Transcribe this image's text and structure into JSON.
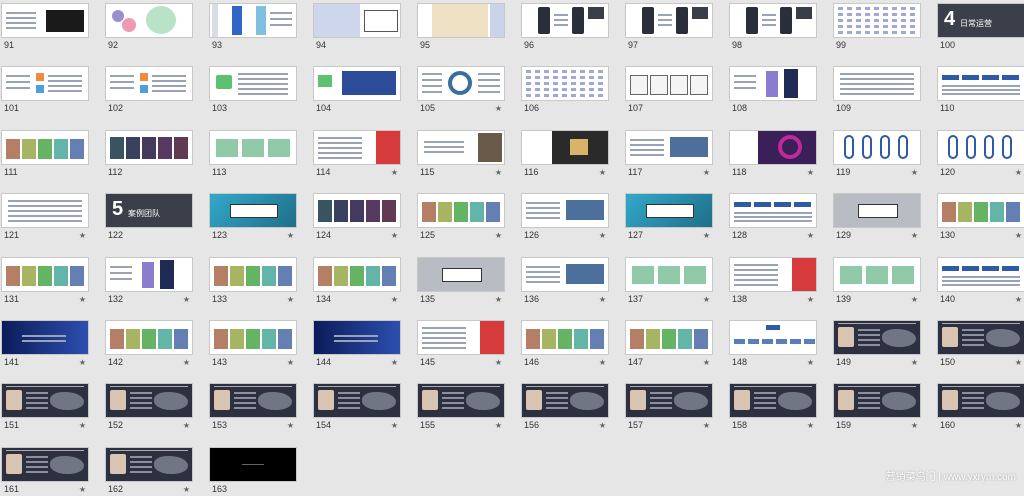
{
  "slides": [
    {
      "n": "91",
      "star": false,
      "style": "split-dark"
    },
    {
      "n": "92",
      "star": false,
      "style": "circles"
    },
    {
      "n": "93",
      "star": false,
      "style": "poster"
    },
    {
      "n": "94",
      "star": false,
      "style": "poster-blue"
    },
    {
      "n": "95",
      "star": false,
      "style": "map-beige"
    },
    {
      "n": "96",
      "star": false,
      "style": "phones"
    },
    {
      "n": "97",
      "star": false,
      "style": "phones"
    },
    {
      "n": "98",
      "star": false,
      "style": "phones"
    },
    {
      "n": "99",
      "star": false,
      "style": "pattern"
    },
    {
      "n": "100",
      "star": false,
      "style": "section",
      "sectionNum": "4",
      "sectionTitle": "日常运营"
    },
    {
      "n": "101",
      "star": false,
      "style": "text-icons"
    },
    {
      "n": "102",
      "star": false,
      "style": "text-icons"
    },
    {
      "n": "103",
      "star": false,
      "style": "green-box"
    },
    {
      "n": "104",
      "star": false,
      "style": "green-blue"
    },
    {
      "n": "105",
      "star": true,
      "style": "wheel"
    },
    {
      "n": "106",
      "star": false,
      "style": "pattern"
    },
    {
      "n": "107",
      "star": false,
      "style": "frames"
    },
    {
      "n": "108",
      "star": false,
      "style": "purple-phone"
    },
    {
      "n": "109",
      "star": false,
      "style": "text"
    },
    {
      "n": "110",
      "star": false,
      "style": "blue-table"
    },
    {
      "n": "111",
      "star": false,
      "style": "photos"
    },
    {
      "n": "112",
      "star": false,
      "style": "photos-dark"
    },
    {
      "n": "113",
      "star": false,
      "style": "green-photos"
    },
    {
      "n": "114",
      "star": true,
      "style": "red-right"
    },
    {
      "n": "115",
      "star": true,
      "style": "photo-right"
    },
    {
      "n": "116",
      "star": true,
      "style": "dark-center"
    },
    {
      "n": "117",
      "star": true,
      "style": "text-photo"
    },
    {
      "n": "118",
      "star": true,
      "style": "purple-spiral"
    },
    {
      "n": "119",
      "star": true,
      "style": "pipes"
    },
    {
      "n": "120",
      "star": true,
      "style": "pipes"
    },
    {
      "n": "121",
      "star": true,
      "style": "text"
    },
    {
      "n": "122",
      "star": false,
      "style": "section",
      "sectionNum": "5",
      "sectionTitle": "案例团队"
    },
    {
      "n": "123",
      "star": true,
      "style": "pool"
    },
    {
      "n": "124",
      "star": true,
      "style": "photos-dark"
    },
    {
      "n": "125",
      "star": true,
      "style": "photos"
    },
    {
      "n": "126",
      "star": true,
      "style": "text-photo"
    },
    {
      "n": "127",
      "star": true,
      "style": "pool"
    },
    {
      "n": "128",
      "star": true,
      "style": "blue-table"
    },
    {
      "n": "129",
      "star": true,
      "style": "building"
    },
    {
      "n": "130",
      "star": true,
      "style": "photos"
    },
    {
      "n": "131",
      "star": true,
      "style": "photos"
    },
    {
      "n": "132",
      "star": true,
      "style": "purple-phone"
    },
    {
      "n": "133",
      "star": true,
      "style": "photos"
    },
    {
      "n": "134",
      "star": true,
      "style": "photos"
    },
    {
      "n": "135",
      "star": true,
      "style": "building"
    },
    {
      "n": "136",
      "star": true,
      "style": "text-photo"
    },
    {
      "n": "137",
      "star": true,
      "style": "green-photos"
    },
    {
      "n": "138",
      "star": true,
      "style": "red-right"
    },
    {
      "n": "139",
      "star": true,
      "style": "green-photos"
    },
    {
      "n": "140",
      "star": true,
      "style": "blue-table"
    },
    {
      "n": "141",
      "star": true,
      "style": "blue-banner"
    },
    {
      "n": "142",
      "star": true,
      "style": "photos"
    },
    {
      "n": "143",
      "star": true,
      "style": "photos"
    },
    {
      "n": "144",
      "star": true,
      "style": "blue-banner"
    },
    {
      "n": "145",
      "star": true,
      "style": "red-right"
    },
    {
      "n": "146",
      "star": true,
      "style": "photos"
    },
    {
      "n": "147",
      "star": true,
      "style": "photos"
    },
    {
      "n": "148",
      "star": true,
      "style": "org-chart"
    },
    {
      "n": "149",
      "star": true,
      "style": "team"
    },
    {
      "n": "150",
      "star": true,
      "style": "team"
    },
    {
      "n": "151",
      "star": true,
      "style": "team"
    },
    {
      "n": "152",
      "star": true,
      "style": "team"
    },
    {
      "n": "153",
      "star": true,
      "style": "team"
    },
    {
      "n": "154",
      "star": true,
      "style": "team"
    },
    {
      "n": "155",
      "star": true,
      "style": "team"
    },
    {
      "n": "156",
      "star": true,
      "style": "team"
    },
    {
      "n": "157",
      "star": true,
      "style": "team"
    },
    {
      "n": "158",
      "star": true,
      "style": "team"
    },
    {
      "n": "159",
      "star": true,
      "style": "team"
    },
    {
      "n": "160",
      "star": true,
      "style": "team"
    },
    {
      "n": "161",
      "star": true,
      "style": "team"
    },
    {
      "n": "162",
      "star": true,
      "style": "team"
    },
    {
      "n": "163",
      "star": false,
      "style": "black"
    }
  ],
  "star_glyph": "★",
  "watermark": "营销菜鸟门 | www.yxrym.com"
}
